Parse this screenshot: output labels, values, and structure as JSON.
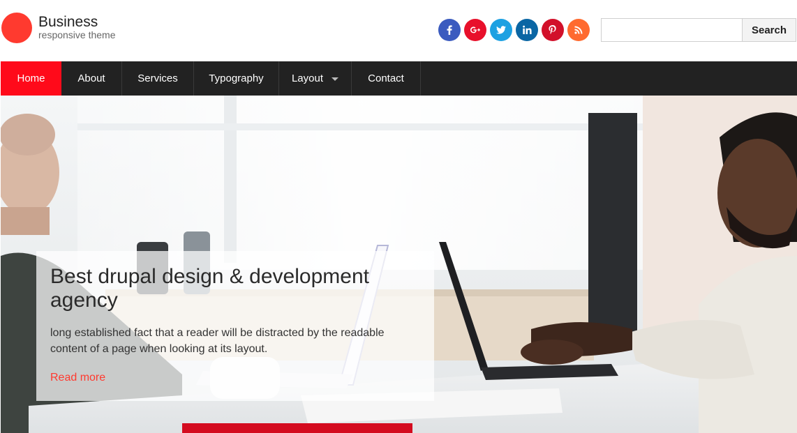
{
  "site": {
    "name": "Business",
    "slogan": "responsive theme",
    "logo_color": "#ff3a2f"
  },
  "social": [
    {
      "icon": "facebook-icon",
      "label": "f",
      "color": "#3b5bbf"
    },
    {
      "icon": "google-plus-icon",
      "label": "G+",
      "color": "#e8102b"
    },
    {
      "icon": "twitter-icon",
      "label": "t",
      "color": "#1da1e2"
    },
    {
      "icon": "linkedin-icon",
      "label": "in",
      "color": "#0a66a4"
    },
    {
      "icon": "pinterest-icon",
      "label": "p",
      "color": "#d2102a"
    },
    {
      "icon": "rss-icon",
      "label": "rss",
      "color": "#ff6a2f"
    }
  ],
  "search": {
    "placeholder": "",
    "value": "",
    "button_label": "Search"
  },
  "nav": {
    "items": [
      {
        "label": "Home",
        "active": true
      },
      {
        "label": "About"
      },
      {
        "label": "Services"
      },
      {
        "label": "Typography"
      },
      {
        "label": "Layout",
        "has_dropdown": true
      },
      {
        "label": "Contact"
      }
    ],
    "active_color": "#ff0a1a",
    "background": "#222222"
  },
  "hero": {
    "title": "Best drupal design & development agency",
    "text": "long established fact that a reader will be distracted by the readable content of a page when looking at its layout.",
    "link_label": "Read more",
    "link_color": "#ff3a2f"
  }
}
